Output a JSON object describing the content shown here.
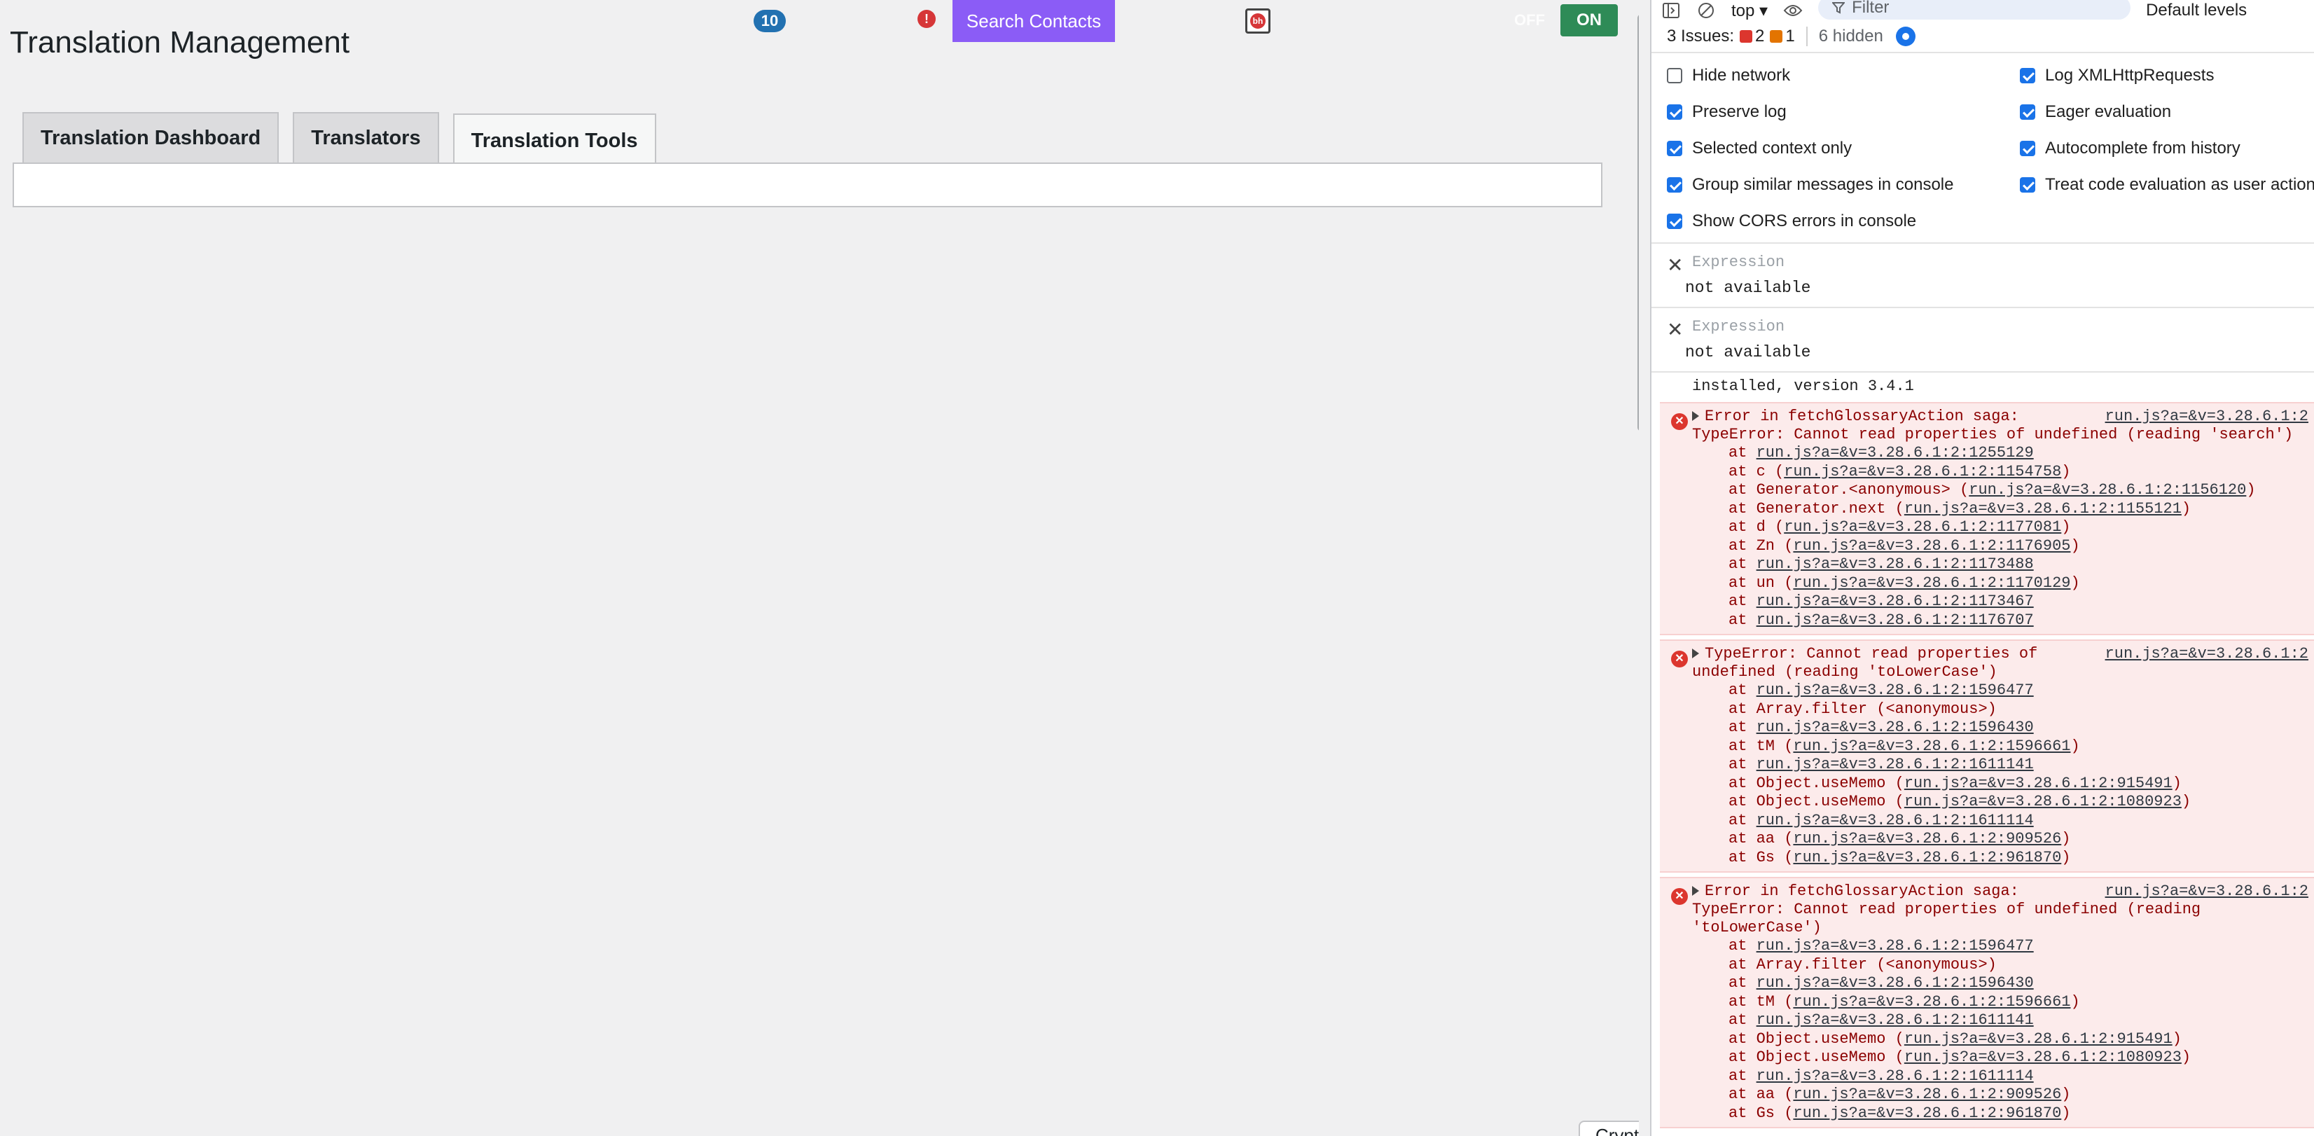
{
  "app": {
    "badge_count": "10",
    "alert_glyph": "!",
    "search_contacts_label": "Search Contacts",
    "ext_icon_glyph": "bh",
    "toggle_off_label": "OFF",
    "toggle_on_label": "ON",
    "page_title": "Translation Management",
    "tabs": [
      {
        "label": "Translation Dashboard",
        "active": false
      },
      {
        "label": "Translators",
        "active": false
      },
      {
        "label": "Translation Tools",
        "active": true
      }
    ],
    "bottom_chip_label": "Cryptometer"
  },
  "devtools": {
    "context": "top ▾",
    "filter_placeholder": "Filter",
    "levels_label": "Default levels",
    "issues": {
      "label": "3 Issues:",
      "errors": "2",
      "warnings": "1",
      "hidden": "6 hidden"
    },
    "settings": [
      {
        "label": "Hide network",
        "checked": false
      },
      {
        "label": "Log XMLHttpRequests",
        "checked": true
      },
      {
        "label": "Preserve log",
        "checked": true
      },
      {
        "label": "Eager evaluation",
        "checked": true
      },
      {
        "label": "Selected context only",
        "checked": true
      },
      {
        "label": "Autocomplete from history",
        "checked": true
      },
      {
        "label": "Group similar messages in console",
        "checked": true
      },
      {
        "label": "Treat code evaluation as user action",
        "checked": true
      },
      {
        "label": "Show CORS errors in console",
        "checked": true
      }
    ],
    "live_expressions": [
      {
        "placeholder": "Expression",
        "value": "not available"
      },
      {
        "placeholder": "Expression",
        "value": "not available"
      }
    ],
    "console_tail": "installed, version 3.4.1",
    "errors": [
      {
        "title": "Error in fetchGlossaryAction saga:",
        "source": "run.js?a=&v=3.28.6.1:2",
        "continuation": "TypeError: Cannot read properties of undefined (reading 'search')",
        "frames": [
          {
            "fn": "",
            "loc": "run.js?a=&v=3.28.6.1:2:1255129"
          },
          {
            "fn": "c",
            "loc": "run.js?a=&v=3.28.6.1:2:1154758"
          },
          {
            "fn": "Generator.<anonymous>",
            "loc": "run.js?a=&v=3.28.6.1:2:1156120"
          },
          {
            "fn": "Generator.next",
            "loc": "run.js?a=&v=3.28.6.1:2:1155121"
          },
          {
            "fn": "d",
            "loc": "run.js?a=&v=3.28.6.1:2:1177081"
          },
          {
            "fn": "Zn",
            "loc": "run.js?a=&v=3.28.6.1:2:1176905"
          },
          {
            "fn": "",
            "loc": "run.js?a=&v=3.28.6.1:2:1173488"
          },
          {
            "fn": "un",
            "loc": "run.js?a=&v=3.28.6.1:2:1170129"
          },
          {
            "fn": "",
            "loc": "run.js?a=&v=3.28.6.1:2:1173467"
          },
          {
            "fn": "",
            "loc": "run.js?a=&v=3.28.6.1:2:1176707"
          }
        ]
      },
      {
        "title": "TypeError: Cannot read properties of",
        "source": "run.js?a=&v=3.28.6.1:2",
        "continuation": "undefined (reading 'toLowerCase')",
        "frames": [
          {
            "fn": "",
            "loc": "run.js?a=&v=3.28.6.1:2:1596477"
          },
          {
            "fn": "Array.filter",
            "loc": "<anonymous>",
            "plain": true
          },
          {
            "fn": "",
            "loc": "run.js?a=&v=3.28.6.1:2:1596430"
          },
          {
            "fn": "tM",
            "loc": "run.js?a=&v=3.28.6.1:2:1596661"
          },
          {
            "fn": "",
            "loc": "run.js?a=&v=3.28.6.1:2:1611141"
          },
          {
            "fn": "Object.useMemo",
            "loc": "run.js?a=&v=3.28.6.1:2:915491"
          },
          {
            "fn": "Object.useMemo",
            "loc": "run.js?a=&v=3.28.6.1:2:1080923"
          },
          {
            "fn": "",
            "loc": "run.js?a=&v=3.28.6.1:2:1611114"
          },
          {
            "fn": "aa",
            "loc": "run.js?a=&v=3.28.6.1:2:909526"
          },
          {
            "fn": "Gs",
            "loc": "run.js?a=&v=3.28.6.1:2:961870"
          }
        ]
      },
      {
        "title": "Error in fetchGlossaryAction saga:",
        "source": "run.js?a=&v=3.28.6.1:2",
        "continuation": "TypeError: Cannot read properties of undefined (reading\n'toLowerCase')",
        "frames": [
          {
            "fn": "",
            "loc": "run.js?a=&v=3.28.6.1:2:1596477"
          },
          {
            "fn": "Array.filter",
            "loc": "<anonymous>",
            "plain": true
          },
          {
            "fn": "",
            "loc": "run.js?a=&v=3.28.6.1:2:1596430"
          },
          {
            "fn": "tM",
            "loc": "run.js?a=&v=3.28.6.1:2:1596661"
          },
          {
            "fn": "",
            "loc": "run.js?a=&v=3.28.6.1:2:1611141"
          },
          {
            "fn": "Object.useMemo",
            "loc": "run.js?a=&v=3.28.6.1:2:915491"
          },
          {
            "fn": "Object.useMemo",
            "loc": "run.js?a=&v=3.28.6.1:2:1080923"
          },
          {
            "fn": "",
            "loc": "run.js?a=&v=3.28.6.1:2:1611114"
          },
          {
            "fn": "aa",
            "loc": "run.js?a=&v=3.28.6.1:2:909526"
          },
          {
            "fn": "Gs",
            "loc": "run.js?a=&v=3.28.6.1:2:961870"
          }
        ]
      }
    ]
  }
}
